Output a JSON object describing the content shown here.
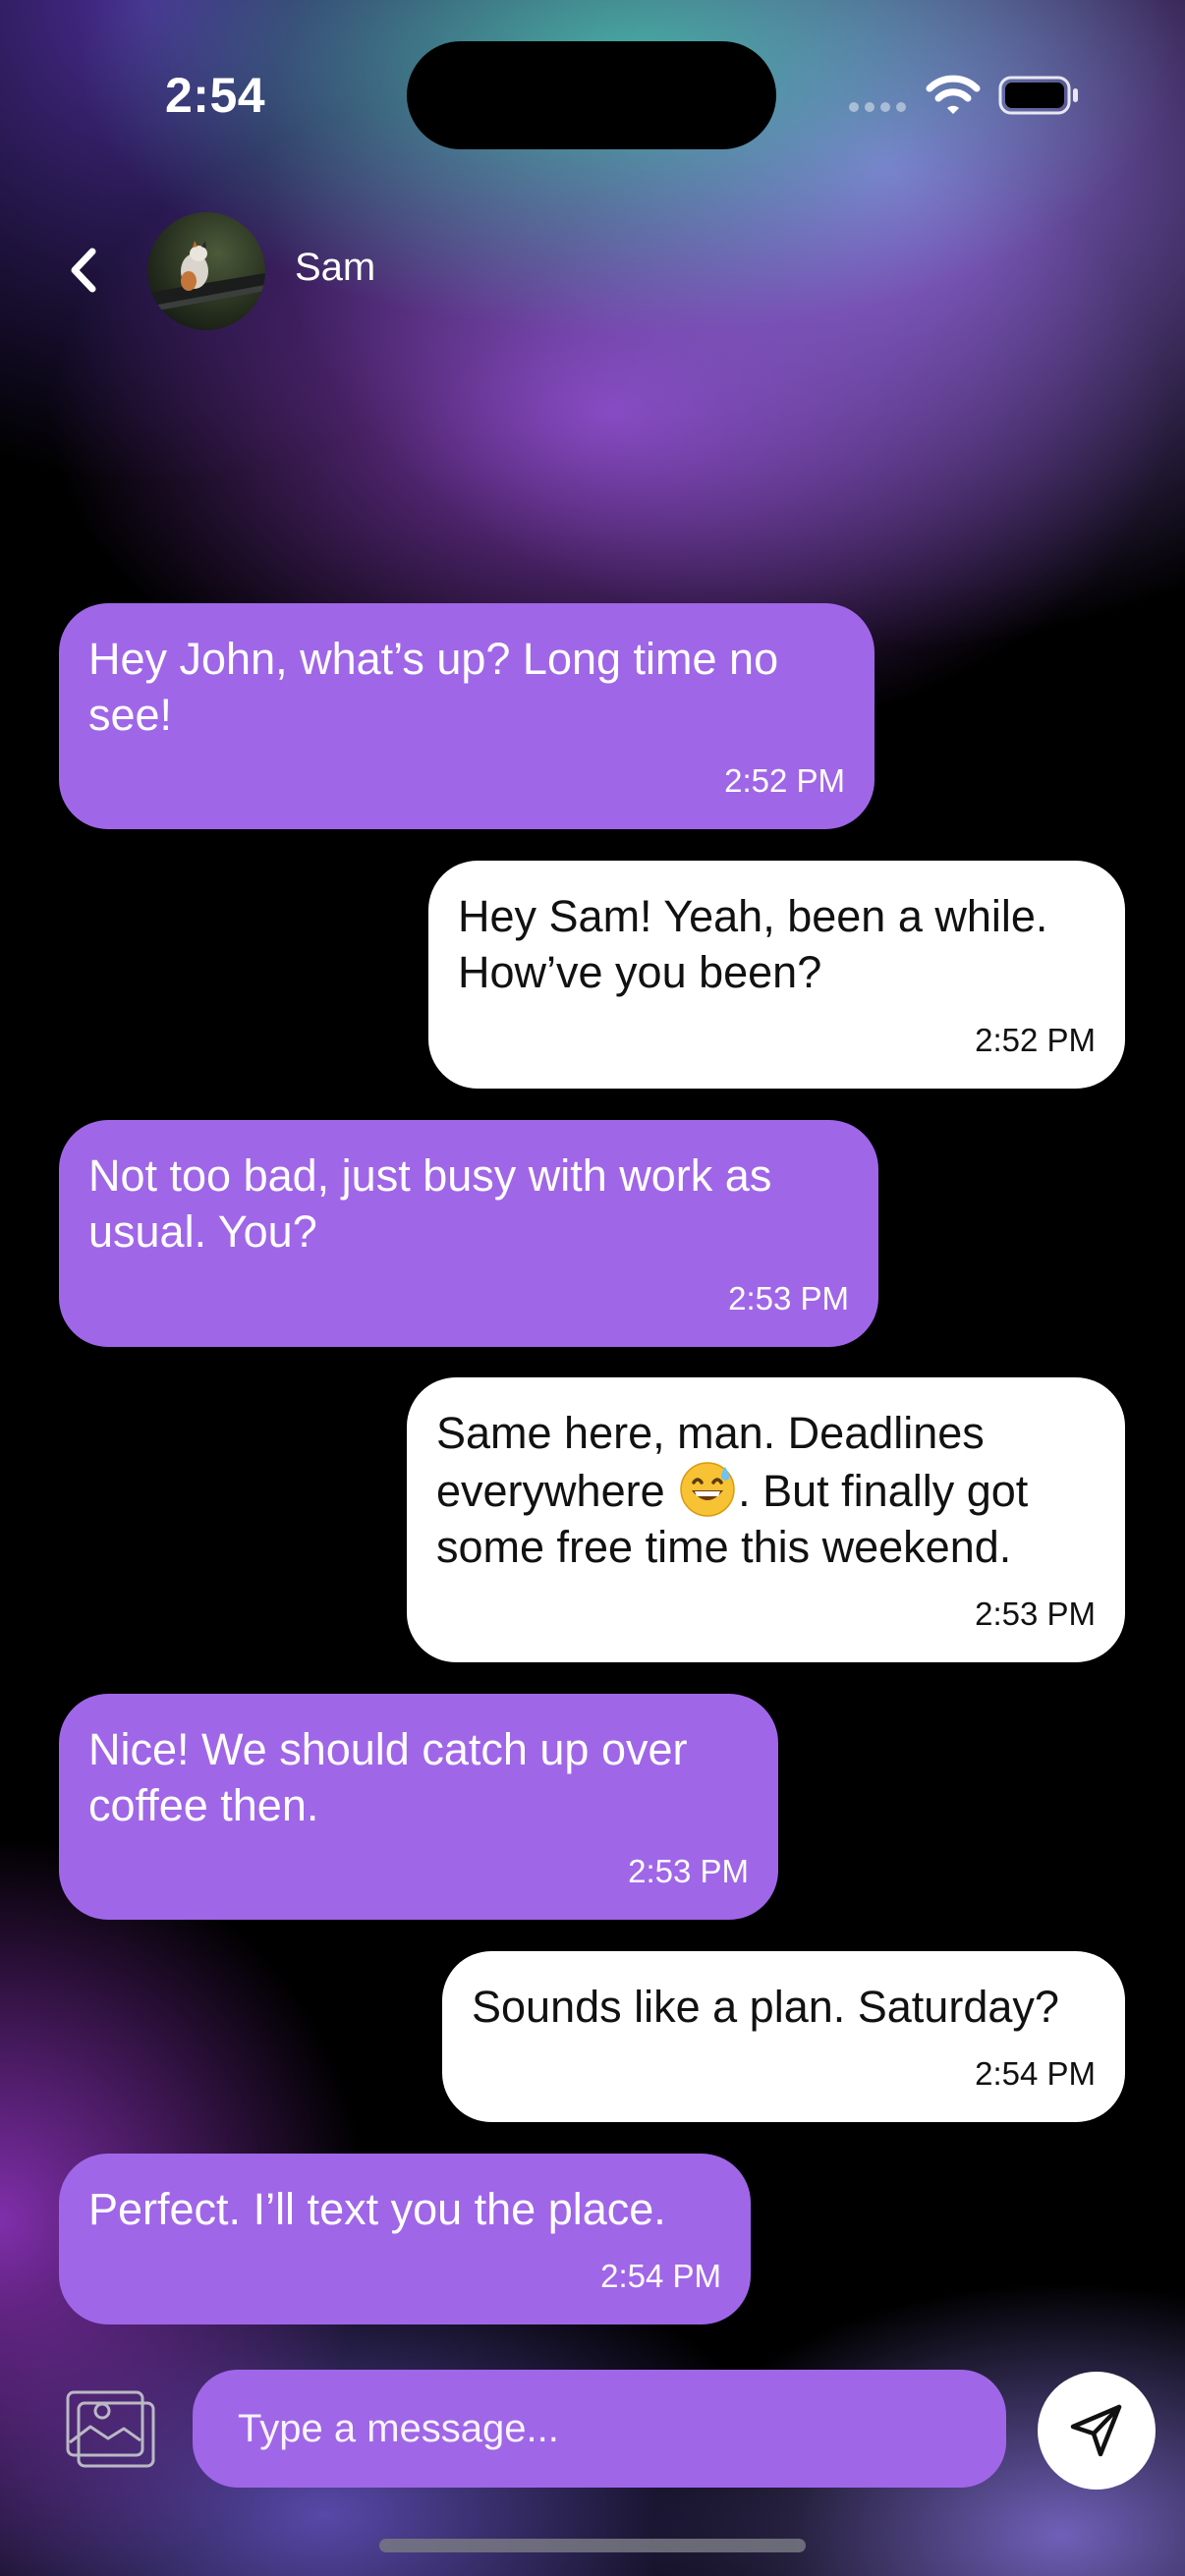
{
  "status_bar": {
    "time": "2:54"
  },
  "header": {
    "contact_name": "Sam",
    "back_icon": "chevron-left-icon",
    "avatar": "contact-photo"
  },
  "messages": [
    {
      "direction": "received",
      "text": "Hey John, what’s up? Long time no see!",
      "time": "2:52 PM"
    },
    {
      "direction": "sent",
      "text": "Hey Sam! Yeah, been a while. How’ve you been?",
      "time": "2:52 PM"
    },
    {
      "direction": "received",
      "text": "Not too bad, just busy with work as usual. You?",
      "time": "2:53 PM"
    },
    {
      "direction": "sent",
      "text_before_emoji": "Same here, man. Deadlines everywhere ",
      "emoji": "😅",
      "text_after_emoji": ". But finally got some free time this weekend.",
      "time": "2:53 PM"
    },
    {
      "direction": "received",
      "text": "Nice! We should catch up over coffee then.",
      "time": "2:53 PM"
    },
    {
      "direction": "sent",
      "text": "Sounds like a plan. Saturday?",
      "time": "2:54 PM"
    },
    {
      "direction": "received",
      "text": "Perfect. I’ll text you the place.",
      "time": "2:54 PM"
    }
  ],
  "composer": {
    "placeholder": "Type a message...",
    "attach_icon": "image-gallery-icon",
    "send_icon": "paper-plane-icon"
  },
  "colors": {
    "received_bubble": "#a066e8",
    "sent_bubble": "#ffffff",
    "input_background": "#a066e8"
  }
}
